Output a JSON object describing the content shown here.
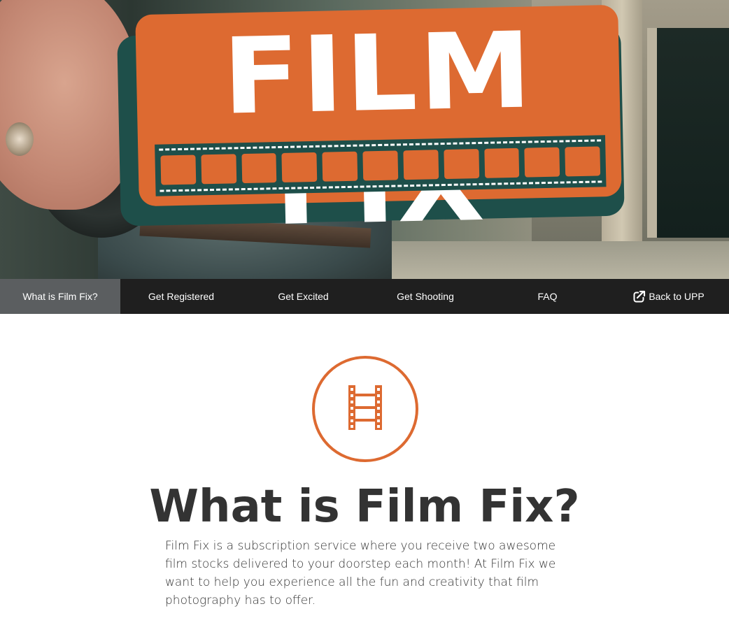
{
  "hero": {
    "logo_text": "FILM FIX",
    "logo_color": "#dd6a31",
    "logo_shadow_color": "#1e4f4a"
  },
  "nav": {
    "items": [
      {
        "label": "What is Film Fix?",
        "active": true
      },
      {
        "label": "Get Registered"
      },
      {
        "label": "Get Excited"
      },
      {
        "label": "Get Shooting"
      },
      {
        "label": "FAQ"
      }
    ],
    "back_label": "Back to UPP",
    "back_icon": "external-link-icon",
    "background": "#1f1f1f",
    "active_background": "#5b5e60"
  },
  "main": {
    "icon": "film-icon",
    "accent": "#dd6a31",
    "heading": "What is Film Fix?",
    "intro": "Film Fix is a subscription service where you receive two awesome film stocks delivered to your doorstep each month! At Film Fix we want to help you experience all the fun and creativity that film photography has to offer."
  }
}
